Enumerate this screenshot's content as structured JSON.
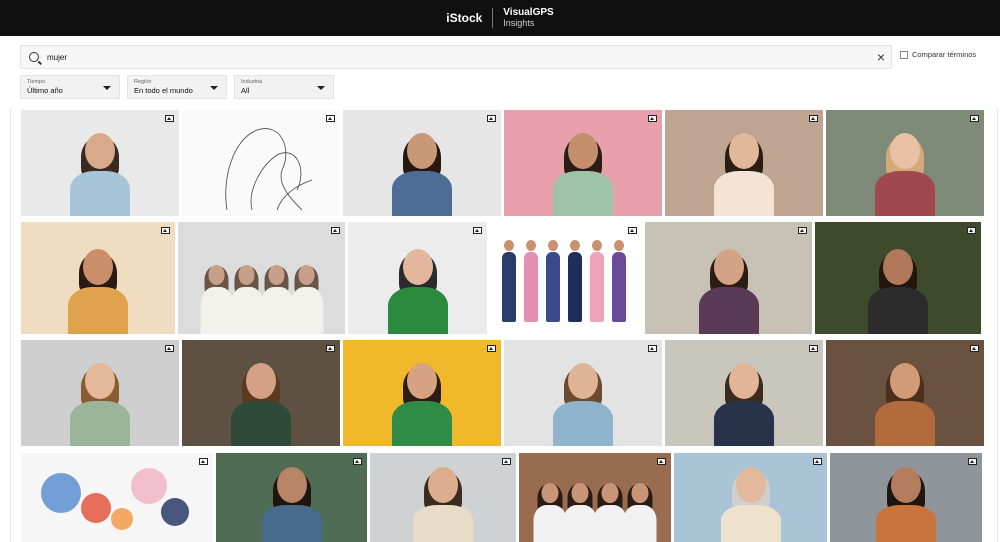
{
  "header": {
    "brand": "iStock",
    "product_line1": "VisualGPS",
    "product_line2": "Insights"
  },
  "search": {
    "value": "mujer",
    "clear_symbol": "×"
  },
  "compare": {
    "label": "Comparar términos"
  },
  "filters": [
    {
      "label": "Tiempo",
      "value": "Último año"
    },
    {
      "label": "Región",
      "value": "En todo el mundo"
    },
    {
      "label": "Industria",
      "value": "All"
    }
  ],
  "icons": {
    "search": "search-icon",
    "clear": "close-icon",
    "caret": "chevron-down-icon",
    "image": "image-icon"
  },
  "rows": [
    [
      {
        "bg": "#e9e9e9",
        "kind": "person",
        "skin": "#d8a98a",
        "hair": "#3a2a20",
        "cloth": "#a7c4d8"
      },
      {
        "bg": "#fafafa",
        "kind": "line"
      },
      {
        "bg": "#e6e6e6",
        "kind": "person",
        "skin": "#c99877",
        "hair": "#241811",
        "cloth": "#4d6c96"
      },
      {
        "bg": "#e8a0ac",
        "kind": "person",
        "skin": "#c68f6c",
        "hair": "#2b1d15",
        "cloth": "#9fc3a7"
      },
      {
        "bg": "#bfa591",
        "kind": "person",
        "skin": "#e2b89b",
        "hair": "#2a1d16",
        "cloth": "#f3e4d6"
      },
      {
        "bg": "#7e8b78",
        "kind": "person",
        "skin": "#e8c1a6",
        "hair": "#d4aa7b",
        "cloth": "#a04750"
      }
    ],
    [
      {
        "bg": "#efdcc1",
        "kind": "person",
        "skin": "#c98f6b",
        "hair": "#2a1a12",
        "cloth": "#e0a34d"
      },
      {
        "bg": "#dcdcdc",
        "kind": "group",
        "skin": "#c7a08a",
        "hair": "#6a5447",
        "cloth": "#f4f1ec"
      },
      {
        "bg": "#ececec",
        "kind": "person",
        "skin": "#e3b79d",
        "hair": "#2b2b2b",
        "cloth": "#2b8a3e"
      },
      {
        "bg": "#ffffff",
        "kind": "illus"
      },
      {
        "bg": "#c8c1b5",
        "kind": "person",
        "skin": "#d3a385",
        "hair": "#2b1d15",
        "cloth": "#5a3a56"
      },
      {
        "bg": "#3d4a2b",
        "kind": "person",
        "skin": "#b07a5a",
        "hair": "#22160f",
        "cloth": "#2c2c2c"
      }
    ],
    [
      {
        "bg": "#cfcfcf",
        "kind": "person",
        "skin": "#e4b898",
        "hair": "#8a5c32",
        "cloth": "#9ab59a"
      },
      {
        "bg": "#5f5142",
        "kind": "person",
        "skin": "#d4a184",
        "hair": "#5c3a22",
        "cloth": "#2e4a3a"
      },
      {
        "bg": "#f1b82c",
        "kind": "person",
        "skin": "#d6a281",
        "hair": "#2b1d15",
        "cloth": "#2e8c46"
      },
      {
        "bg": "#e3e3e3",
        "kind": "person",
        "skin": "#dfb395",
        "hair": "#6b4a2f",
        "cloth": "#8fb4cc"
      },
      {
        "bg": "#c9c6bd",
        "kind": "person",
        "skin": "#e2b597",
        "hair": "#3a2a20",
        "cloth": "#26334a"
      },
      {
        "bg": "#6a5140",
        "kind": "person",
        "skin": "#d29b78",
        "hair": "#4a2f1c",
        "cloth": "#b36b3e"
      }
    ],
    [
      {
        "bg": "#f6f6f6",
        "kind": "illus2"
      },
      {
        "bg": "#4f6d54",
        "kind": "person",
        "skin": "#b88566",
        "hair": "#1f1510",
        "cloth": "#466b8c"
      },
      {
        "bg": "#cfd2d3",
        "kind": "person",
        "skin": "#dcae8f",
        "hair": "#3c2a1e",
        "cloth": "#e8dcc8"
      },
      {
        "bg": "#9a6c4f",
        "kind": "group",
        "skin": "#c89676",
        "hair": "#2a1c14",
        "cloth": "#f2f2f2"
      },
      {
        "bg": "#a9c4d6",
        "kind": "person",
        "skin": "#e3b89c",
        "hair": "#cfcfcf",
        "cloth": "#efe2cd"
      },
      {
        "bg": "#8f959a",
        "kind": "person",
        "skin": "#b47e5e",
        "hair": "#1f1510",
        "cloth": "#c9733d"
      }
    ]
  ]
}
